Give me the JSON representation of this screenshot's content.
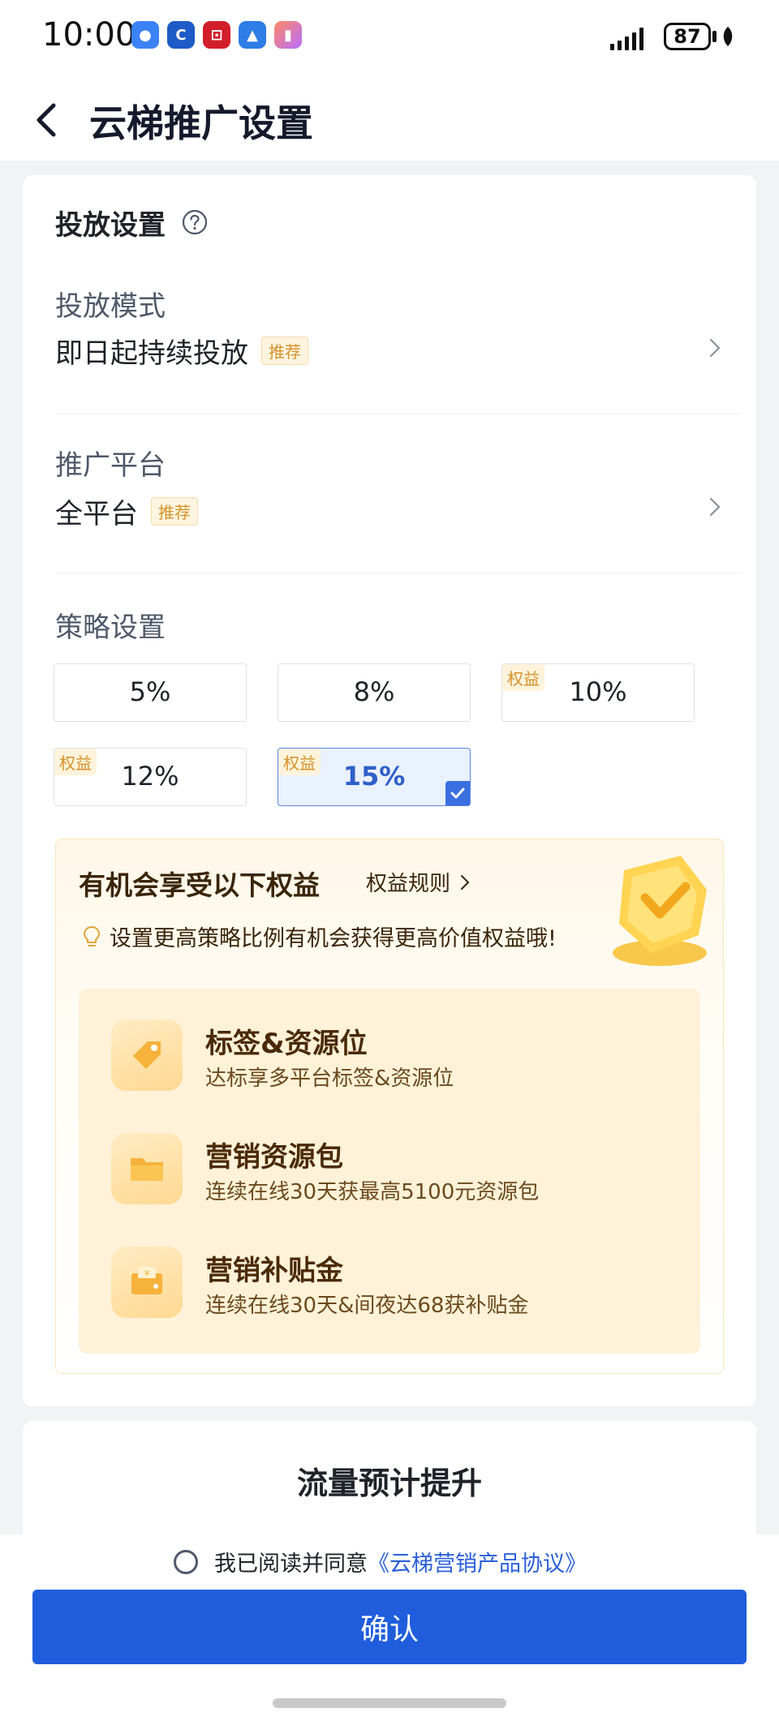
{
  "status": {
    "time": "10:00",
    "battery": "87"
  },
  "nav": {
    "title": "云梯推广设置"
  },
  "delivery": {
    "section_title": "投放设置",
    "mode_label": "投放模式",
    "mode_value": "即日起持续投放",
    "mode_badge": "推荐",
    "platform_label": "推广平台",
    "platform_value": "全平台",
    "platform_badge": "推荐",
    "strategy_label": "策略设置",
    "options": [
      {
        "value": "5%",
        "tag": ""
      },
      {
        "value": "8%",
        "tag": ""
      },
      {
        "value": "10%",
        "tag": "权益"
      },
      {
        "value": "12%",
        "tag": "权益"
      },
      {
        "value": "15%",
        "tag": "权益",
        "selected": true
      }
    ]
  },
  "rights": {
    "title": "有机会享受以下权益",
    "rule_link": "权益规则",
    "tip": "设置更高策略比例有机会获得更高价值权益哦!",
    "items": [
      {
        "icon": "tag-icon",
        "title": "标签&资源位",
        "desc": "达标享多平台标签&资源位"
      },
      {
        "icon": "folder-icon",
        "title": "营销资源包",
        "desc": "连续在线30天获最高5100元资源包"
      },
      {
        "icon": "wallet-icon",
        "title": "营销补贴金",
        "desc": "连续在线30天&间夜达68获补贴金"
      }
    ]
  },
  "traffic": {
    "title": "流量预计提升"
  },
  "footer": {
    "agree_text": "我已阅读并同意",
    "agree_link": "《云梯营销产品协议》",
    "confirm_label": "确认"
  },
  "colors": {
    "primary": "#1f5ddc",
    "accent_gold": "#d4922a",
    "selected_bg": "#eaf1ff"
  }
}
